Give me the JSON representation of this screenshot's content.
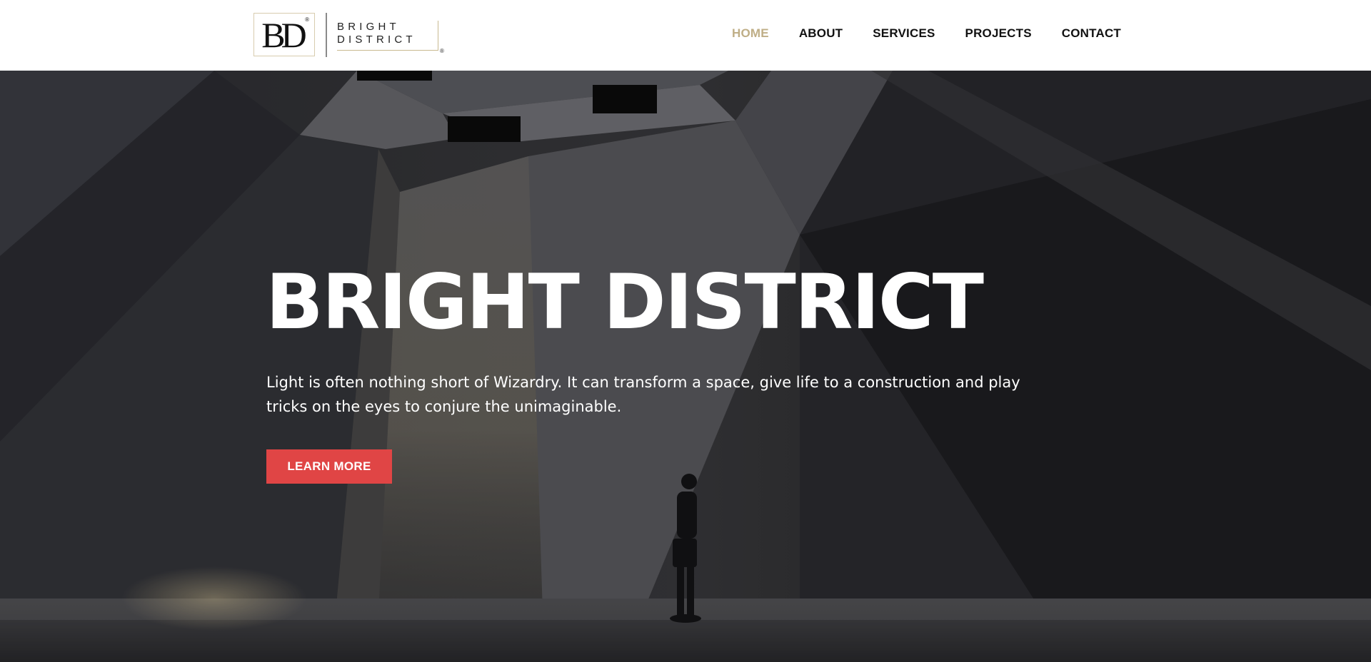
{
  "logo": {
    "monogram": "BD",
    "monogram_reg": "®",
    "word_line1": "BRIGHT",
    "word_line2": "DISTRICT",
    "word_reg": "®"
  },
  "nav": {
    "items": [
      {
        "label": "HOME",
        "active": true
      },
      {
        "label": "ABOUT",
        "active": false
      },
      {
        "label": "SERVICES",
        "active": false
      },
      {
        "label": "PROJECTS",
        "active": false
      },
      {
        "label": "CONTACT",
        "active": false
      }
    ]
  },
  "hero": {
    "title": "BRIGHT DISTRICT",
    "text": "Light is often nothing short of Wizardry. It can transform a space, give life to a construction and play tricks on the eyes to conjure the unimaginable.",
    "button_label": "LEARN MORE"
  },
  "colors": {
    "accent": "#bfae86",
    "button": "#e04545",
    "header_bg": "#ffffff",
    "hero_text": "#ffffff"
  }
}
